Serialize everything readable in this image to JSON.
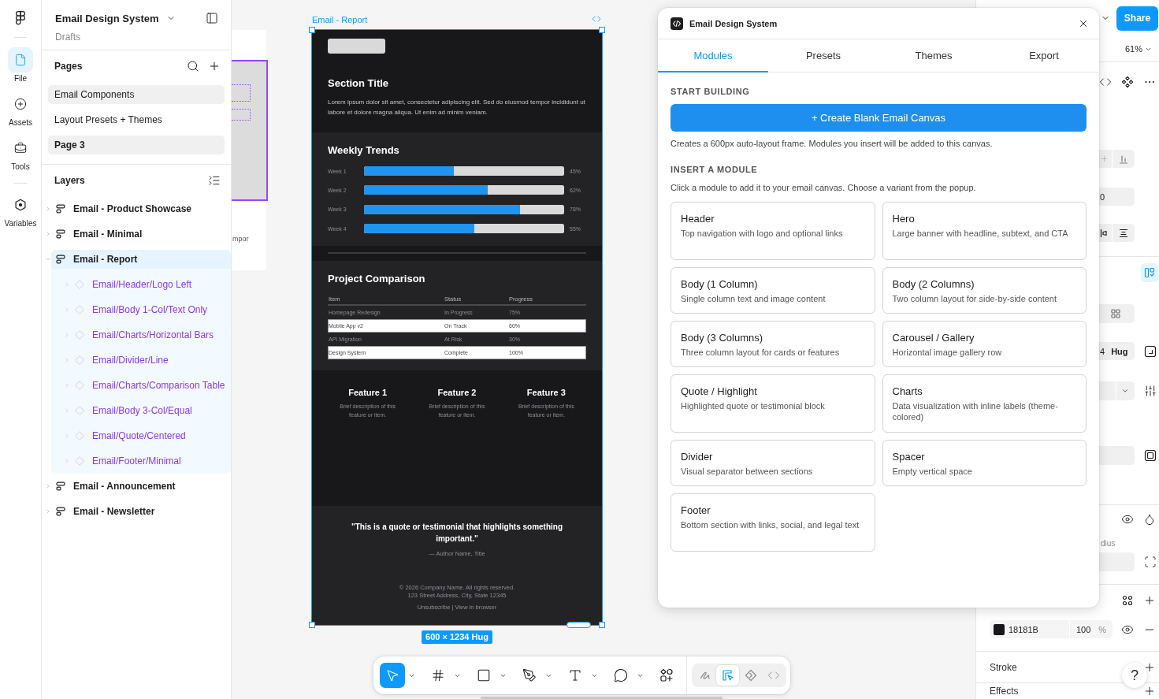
{
  "rail": {
    "items": [
      {
        "label": "File",
        "selected": true
      },
      {
        "label": "Assets",
        "selected": false
      },
      {
        "label": "Tools",
        "selected": false
      },
      {
        "label": "Variables",
        "selected": false
      }
    ]
  },
  "file": {
    "title": "Email Design System",
    "location": "Drafts"
  },
  "pages": {
    "heading": "Pages",
    "items": [
      {
        "label": "Email Components",
        "selected": false,
        "hovered": true
      },
      {
        "label": "Layout Presets + Themes",
        "selected": false,
        "hovered": false
      },
      {
        "label": "Page 3",
        "selected": true,
        "hovered": false
      }
    ]
  },
  "layers": {
    "heading": "Layers",
    "items": [
      {
        "label": "Email - Product Showcase",
        "expanded": false,
        "selected": false
      },
      {
        "label": "Email - Minimal",
        "expanded": false,
        "selected": false
      },
      {
        "label": "Email - Report",
        "expanded": true,
        "selected": true,
        "children": [
          {
            "label": "Email/Header/Logo Left",
            "expanded": false
          },
          {
            "label": "Email/Body 1-Col/Text Only",
            "expanded": false
          },
          {
            "label": "Email/Charts/Horizontal Bars",
            "expanded": false
          },
          {
            "label": "Email/Divider/Line",
            "expanded": false
          },
          {
            "label": "Email/Charts/Comparison Table",
            "expanded": false
          },
          {
            "label": "Email/Body 3-Col/Equal",
            "expanded": false
          },
          {
            "label": "Email/Quote/Centered",
            "expanded": false
          },
          {
            "label": "Email/Footer/Minimal",
            "expanded": false
          }
        ]
      },
      {
        "label": "Email - Announcement",
        "expanded": false,
        "selected": false
      },
      {
        "label": "Email - Newsletter",
        "expanded": false,
        "selected": false
      }
    ]
  },
  "canvas": {
    "partial_frame": {
      "text": "mpor"
    },
    "frame": {
      "label": "Email - Report",
      "size": "600 × 1234 Hug",
      "email": {
        "header": {
          "title": "Section Title",
          "body": "Lorem ipsum dolor sit amet, consectetur adipiscing elit. Sed do eiusmod tempor incididunt ut labore et dolore magna aliqua. Ut enim ad minim veniam."
        },
        "trends": {
          "title": "Weekly Trends",
          "bars": [
            {
              "label": "Week 1",
              "level": 0.45,
              "reading": "45%"
            },
            {
              "label": "Week 2",
              "level": 0.62,
              "reading": "62%"
            },
            {
              "label": "Week 3",
              "level": 0.78,
              "reading": "78%"
            },
            {
              "label": "Week 4",
              "level": 0.55,
              "reading": "55%"
            }
          ]
        },
        "table": {
          "title": "Project Comparison",
          "columns": [
            "Item",
            "Status",
            "Progress"
          ],
          "rows": [
            [
              "Homepage Redesign",
              "In Progress",
              "75%"
            ],
            [
              "Mobile App v2",
              "On Track",
              "60%"
            ],
            [
              "API Migration",
              "At Risk",
              "30%"
            ],
            [
              "Design System",
              "Complete",
              "100%"
            ]
          ]
        },
        "features": [
          {
            "title": "Feature 1",
            "description": "Brief description of this feature or item."
          },
          {
            "title": "Feature 2",
            "description": "Brief description of this feature or item."
          },
          {
            "title": "Feature 3",
            "description": "Brief description of this feature or item."
          }
        ],
        "quote": {
          "text": "\"This is a quote or testimonial that highlights something important.\"",
          "attribution": "— Author Name, Title"
        },
        "footer": {
          "lines": [
            "© 2026 Company Name. All rights reserved.",
            "123 Street Address, City, State 12345"
          ],
          "links": "Unsubscribe | View in browser"
        }
      }
    }
  },
  "toolbar": {
    "tools": [
      {
        "kind": "move",
        "selected": true,
        "dropdown": true
      },
      {
        "kind": "frame",
        "selected": false,
        "dropdown": true
      },
      {
        "kind": "rectangle",
        "selected": false,
        "dropdown": true
      },
      {
        "kind": "pen",
        "selected": false,
        "dropdown": true
      },
      {
        "kind": "text",
        "selected": false,
        "dropdown": true
      },
      {
        "kind": "comment",
        "selected": false,
        "dropdown": true
      },
      {
        "kind": "actions",
        "selected": false,
        "dropdown": false
      }
    ],
    "modes": [
      {
        "kind": "draw",
        "selected": false
      },
      {
        "kind": "design",
        "selected": true
      },
      {
        "kind": "component",
        "selected": false
      },
      {
        "kind": "code",
        "selected": false
      }
    ]
  },
  "plugin": {
    "title": "Email Design System",
    "tabs": [
      {
        "label": "Modules",
        "selected": true
      },
      {
        "label": "Presets",
        "selected": false
      },
      {
        "label": "Themes",
        "selected": false
      },
      {
        "label": "Export",
        "selected": false
      }
    ],
    "start_heading": "START BUILDING",
    "create_button": "+ Create Blank Email Canvas",
    "create_note": "Creates a 600px auto-layout frame. Modules you insert will be added to this canvas.",
    "insert_heading": "INSERT A MODULE",
    "insert_note": "Click a module to add it to your email canvas. Choose a variant from the popup.",
    "modules": [
      {
        "title": "Header",
        "description": "Top navigation with logo and optional links"
      },
      {
        "title": "Hero",
        "description": "Large banner with headline, subtext, and CTA"
      },
      {
        "title": "Body (1 Column)",
        "description": "Single column text and image content"
      },
      {
        "title": "Body (2 Columns)",
        "description": "Two column layout for side-by-side content"
      },
      {
        "title": "Body (3 Columns)",
        "description": "Three column layout for cards or features"
      },
      {
        "title": "Carousel / Gallery",
        "description": "Horizontal image gallery row"
      },
      {
        "title": "Quote / Highlight",
        "description": "Highlighted quote or testimonial block"
      },
      {
        "title": "Charts",
        "description": "Data visualization with inline labels (theme-colored)"
      },
      {
        "title": "Divider",
        "description": "Visual separator between sections"
      },
      {
        "title": "Spacer",
        "description": "Empty vertical space"
      },
      {
        "title": "Footer",
        "description": "Bottom section with links, social, and legal text"
      }
    ]
  },
  "properties": {
    "share_button": "Share",
    "zoom": "61%",
    "partial_value": "0",
    "size_field": {
      "value": "4",
      "mode": "Hug"
    },
    "partial_label": "dius",
    "fill": {
      "hex": "18181B",
      "opacity": "100",
      "unit": "%"
    },
    "sections": [
      {
        "title": "Stroke"
      },
      {
        "title": "Effects"
      }
    ],
    "help_button": "?"
  }
}
